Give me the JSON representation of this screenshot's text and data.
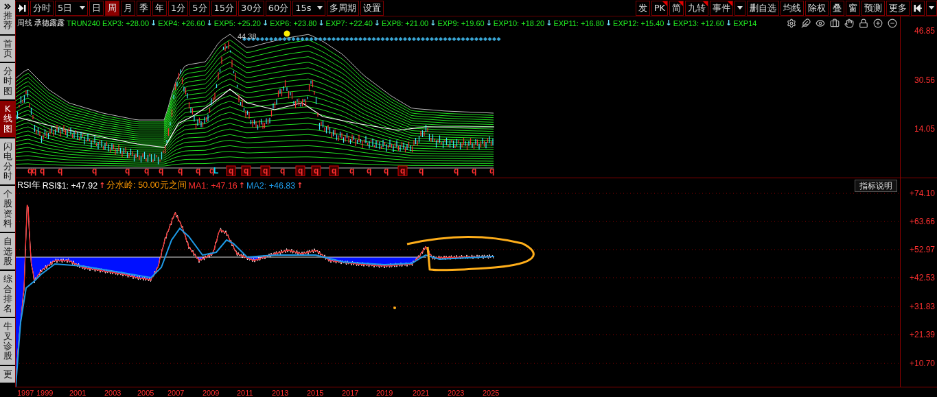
{
  "sidebar": {
    "tabs": [
      {
        "label": "推荐",
        "selected": false,
        "kind": "collapse"
      },
      {
        "label": "首页",
        "selected": false,
        "kind": "tab"
      },
      {
        "label": "分时图",
        "selected": false,
        "kind": "tab"
      },
      {
        "label": "K线图",
        "selected": true,
        "kind": "tab"
      },
      {
        "label": "闪电分时",
        "selected": false,
        "kind": "tab"
      },
      {
        "label": "个股资料",
        "selected": false,
        "kind": "tab"
      },
      {
        "label": "自选股",
        "selected": false,
        "kind": "tab"
      },
      {
        "label": "综合排名",
        "selected": false,
        "kind": "tab"
      },
      {
        "label": "牛叉诊股",
        "selected": false,
        "kind": "tab"
      },
      {
        "label": "更",
        "selected": false,
        "kind": "tab"
      }
    ]
  },
  "toolbar": {
    "left": [
      {
        "label": "分时",
        "selected": false,
        "kind": "button"
      },
      {
        "label": "5日",
        "selected": false,
        "kind": "dropdown"
      },
      {
        "label": "日",
        "selected": false,
        "kind": "button"
      },
      {
        "label": "周",
        "selected": true,
        "kind": "button"
      },
      {
        "label": "月",
        "selected": false,
        "kind": "button"
      },
      {
        "label": "季",
        "selected": false,
        "kind": "button"
      },
      {
        "label": "年",
        "selected": false,
        "kind": "button"
      },
      {
        "label": "1分",
        "selected": false,
        "kind": "button"
      },
      {
        "label": "5分",
        "selected": false,
        "kind": "button"
      },
      {
        "label": "15分",
        "selected": false,
        "kind": "button"
      },
      {
        "label": "30分",
        "selected": false,
        "kind": "button"
      },
      {
        "label": "60分",
        "selected": false,
        "kind": "button"
      },
      {
        "label": "15s",
        "selected": false,
        "kind": "dropdown"
      },
      {
        "label": "多周期",
        "selected": false,
        "kind": "button"
      },
      {
        "label": "设置",
        "selected": false,
        "kind": "button"
      }
    ],
    "right": [
      {
        "label": "发",
        "marked": false,
        "kind": "button"
      },
      {
        "label": "PK",
        "marked": true,
        "kind": "button"
      },
      {
        "label": "简",
        "marked": true,
        "kind": "button"
      },
      {
        "label": "九转",
        "marked": true,
        "kind": "button"
      },
      {
        "label": "事件",
        "marked": true,
        "kind": "button"
      },
      {
        "kind": "caret"
      },
      {
        "label": "删自选",
        "marked": false,
        "kind": "button"
      },
      {
        "label": "均线",
        "marked": false,
        "kind": "button"
      },
      {
        "label": "除权",
        "marked": false,
        "kind": "button"
      },
      {
        "label": "叠",
        "marked": false,
        "kind": "button"
      },
      {
        "label": "窗",
        "marked": false,
        "kind": "button"
      },
      {
        "label": "预测",
        "marked": false,
        "kind": "button"
      },
      {
        "label": "更多",
        "marked": false,
        "kind": "button"
      }
    ]
  },
  "price_chart": {
    "legend": {
      "period": "周线",
      "name": "承德露露",
      "indicator": "TRUN240",
      "lines": [
        {
          "text": "EXP3: +28.00",
          "arrow": "↓"
        },
        {
          "text": "EXP4: +26.60",
          "arrow": "↓"
        },
        {
          "text": "EXP5: +25.20",
          "arrow": "↓"
        },
        {
          "text": "EXP6: +23.80",
          "arrow": "↓"
        },
        {
          "text": "EXP7: +22.40",
          "arrow": "↓"
        },
        {
          "text": "EXP8: +21.00",
          "arrow": "↓"
        },
        {
          "text": "EXP9: +19.60",
          "arrow": "↓"
        },
        {
          "text": "EXP10: +18.20",
          "arrow": "↓"
        },
        {
          "text": "EXP11: +16.80",
          "arrow": "↓"
        },
        {
          "text": "EXP12: +15.40",
          "arrow": "↓"
        },
        {
          "text": "EXP13: +12.60",
          "arrow": "↓"
        },
        {
          "text": "EXP14"
        }
      ]
    },
    "peak_label": "44.38",
    "axis": [
      "46.85",
      "30.56",
      "14.05"
    ],
    "signals": [
      {
        "label": "q",
        "boxed": false,
        "color": "#ff3030"
      },
      {
        "label": "q",
        "boxed": false,
        "color": "#ff3030"
      },
      {
        "label": "q",
        "boxed": false,
        "color": "#ff3030"
      },
      {
        "label": "q",
        "boxed": false,
        "color": "#ff3030"
      },
      {
        "label": "q",
        "boxed": false,
        "color": "#ff3030"
      },
      {
        "label": "q",
        "boxed": false,
        "color": "#ff3030"
      },
      {
        "label": "q",
        "boxed": false,
        "color": "#ff3030"
      },
      {
        "label": "q",
        "boxed": false,
        "color": "#ff3030"
      },
      {
        "label": "q",
        "boxed": false,
        "color": "#ff3030"
      },
      {
        "label": "q",
        "boxed": false,
        "color": "#ff3030"
      },
      {
        "label": "q",
        "boxed": false,
        "color": "#ff3030"
      },
      {
        "label": "L",
        "boxed": false,
        "color": "#00e0ff"
      },
      {
        "label": "q",
        "boxed": true,
        "color": "#ff3030"
      },
      {
        "label": "q",
        "boxed": true,
        "color": "#ff3030"
      },
      {
        "label": "q",
        "boxed": true,
        "color": "#ff3030"
      },
      {
        "label": "q",
        "boxed": false,
        "color": "#ff3030"
      },
      {
        "label": "q",
        "boxed": true,
        "color": "#ff3030"
      },
      {
        "label": "q",
        "boxed": true,
        "color": "#ff3030"
      },
      {
        "label": "q",
        "boxed": true,
        "color": "#ff3030"
      },
      {
        "label": "q",
        "boxed": false,
        "color": "#ff3030"
      },
      {
        "label": "q",
        "boxed": false,
        "color": "#ff3030"
      },
      {
        "label": "q",
        "boxed": false,
        "color": "#ff3030"
      },
      {
        "label": "q",
        "boxed": true,
        "color": "#ff3030"
      },
      {
        "label": "q",
        "boxed": false,
        "color": "#ff3030"
      },
      {
        "label": "q",
        "boxed": false,
        "color": "#ff3030"
      },
      {
        "label": "q",
        "boxed": false,
        "color": "#ff3030"
      },
      {
        "label": "q",
        "boxed": false,
        "color": "#ff3030"
      }
    ]
  },
  "indicator_chart": {
    "legend": [
      {
        "text": "RSI年",
        "color": "#ffffff"
      },
      {
        "text": "RSI$1: +47.92",
        "color": "#ffffff",
        "arrow": "↑"
      },
      {
        "text": "分水岭: 50.00元之间",
        "color": "#ff9900"
      },
      {
        "text": "MA1: +47.16",
        "color": "#ff3030",
        "arrow": "↑"
      },
      {
        "text": "MA2: +46.83",
        "color": "#1e9be8",
        "arrow": "↑"
      }
    ],
    "button": "指标说明",
    "axis": [
      "+74.10",
      "+63.66",
      "+52.97",
      "+42.53",
      "+31.83",
      "+21.39",
      "+10.70"
    ]
  },
  "years": [
    "1997",
    "1999",
    "2001",
    "2003",
    "2005",
    "2007",
    "2009",
    "2011",
    "2013",
    "2015",
    "2017",
    "2019",
    "2021",
    "2023",
    "2025"
  ]
}
